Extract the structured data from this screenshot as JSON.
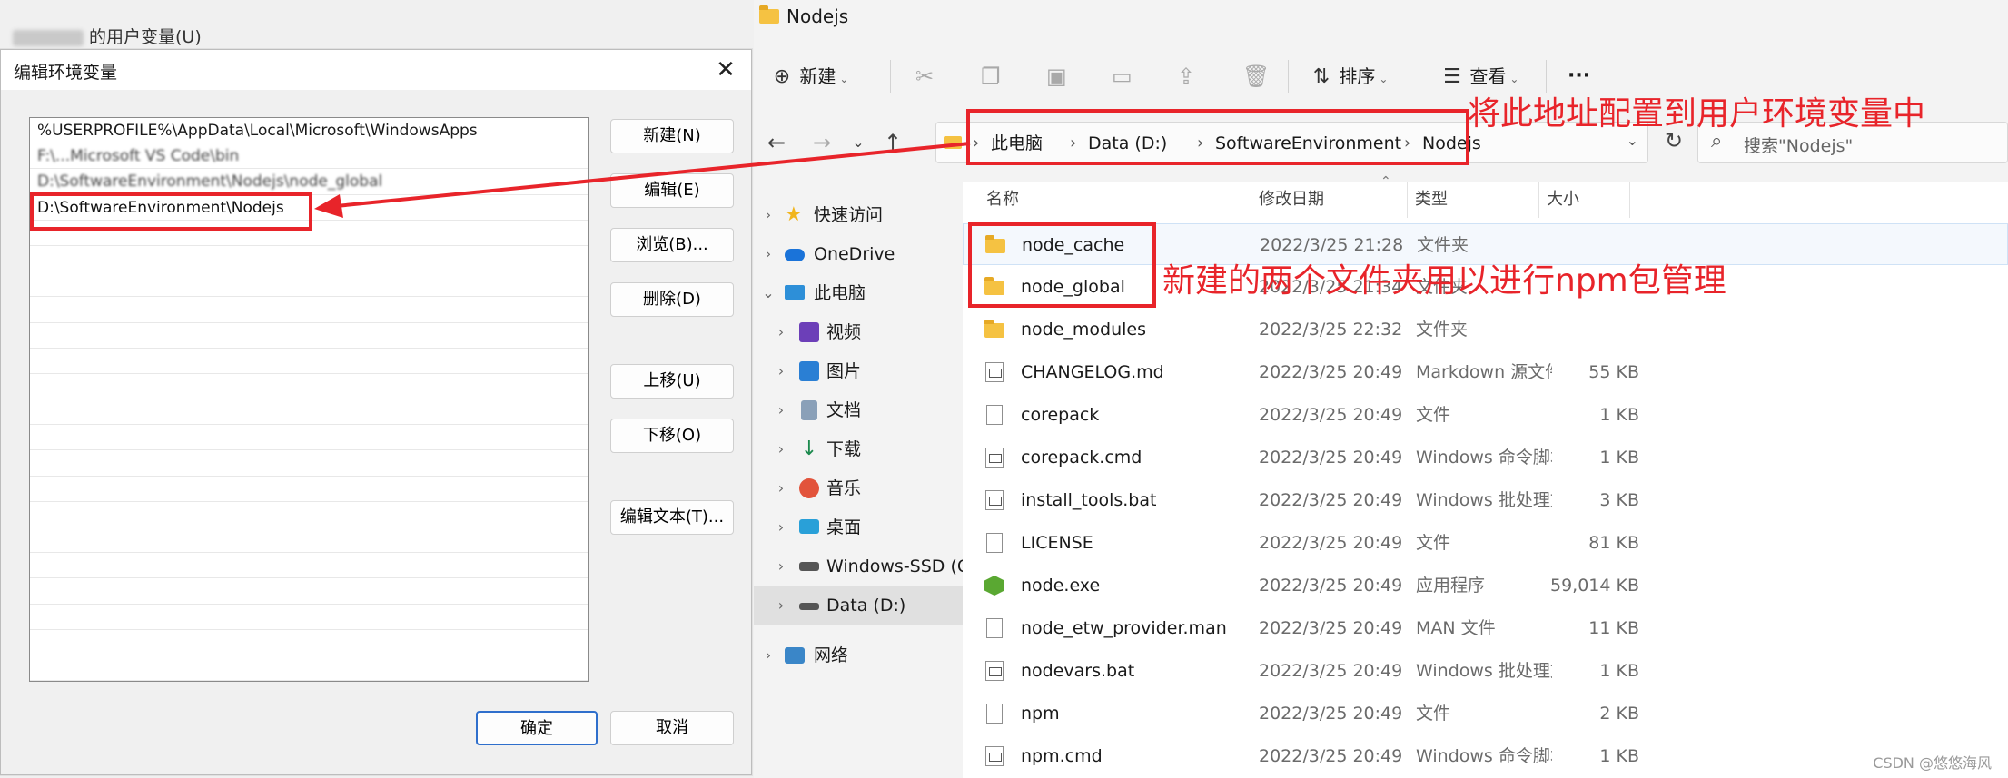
{
  "dialog": {
    "parent_title": "的用户变量(U)",
    "title": "编辑环境变量",
    "close_glyph": "✕",
    "paths": [
      "%USERPROFILE%\\AppData\\Local\\Microsoft\\WindowsApps",
      "F:\\...Microsoft VS Code\\bin",
      "D:\\SoftwareEnvironment\\Nodejs\\node_global",
      "D:\\SoftwareEnvironment\\Nodejs"
    ],
    "buttons": {
      "new": "新建(N)",
      "edit": "编辑(E)",
      "browse": "浏览(B)...",
      "delete": "删除(D)",
      "move_up": "上移(U)",
      "move_down": "下移(O)",
      "edit_text": "编辑文本(T)...",
      "ok": "确定",
      "cancel": "取消"
    }
  },
  "explorer": {
    "title": "Nodejs",
    "toolbar": {
      "new": "新建",
      "sort": "排序",
      "view": "查看",
      "more": "···"
    },
    "breadcrumb": [
      "此电脑",
      "Data (D:)",
      "SoftwareEnvironment",
      "Nodejs"
    ],
    "search_placeholder": "搜索\"Nodejs\"",
    "columns": {
      "name": "名称",
      "date": "修改日期",
      "type": "类型",
      "size": "大小"
    },
    "nav": [
      {
        "label": "快速访问",
        "icon": "star-icon"
      },
      {
        "label": "OneDrive",
        "icon": "cloud-icon"
      },
      {
        "label": "此电脑",
        "icon": "computer-icon"
      },
      {
        "label": "视频",
        "icon": "video-icon"
      },
      {
        "label": "图片",
        "icon": "picture-icon"
      },
      {
        "label": "文档",
        "icon": "document-icon"
      },
      {
        "label": "下载",
        "icon": "download-icon"
      },
      {
        "label": "音乐",
        "icon": "music-icon"
      },
      {
        "label": "桌面",
        "icon": "desktop-icon"
      },
      {
        "label": "Windows-SSD (C",
        "icon": "drive-icon"
      },
      {
        "label": "Data (D:)",
        "icon": "drive-icon"
      },
      {
        "label": "网络",
        "icon": "network-icon"
      }
    ],
    "files": [
      {
        "name": "node_cache",
        "date": "2022/3/25 21:28",
        "type": "文件夹",
        "size": "",
        "kind": "folder"
      },
      {
        "name": "node_global",
        "date": "2022/3/25 21:34",
        "type": "文件夹",
        "size": "",
        "kind": "folder"
      },
      {
        "name": "node_modules",
        "date": "2022/3/25 22:32",
        "type": "文件夹",
        "size": "",
        "kind": "folder"
      },
      {
        "name": "CHANGELOG.md",
        "date": "2022/3/25 20:49",
        "type": "Markdown 源文件",
        "size": "55 KB",
        "kind": "script"
      },
      {
        "name": "corepack",
        "date": "2022/3/25 20:49",
        "type": "文件",
        "size": "1 KB",
        "kind": "doc"
      },
      {
        "name": "corepack.cmd",
        "date": "2022/3/25 20:49",
        "type": "Windows 命令脚本",
        "size": "1 KB",
        "kind": "script"
      },
      {
        "name": "install_tools.bat",
        "date": "2022/3/25 20:49",
        "type": "Windows 批处理文...",
        "size": "3 KB",
        "kind": "script"
      },
      {
        "name": "LICENSE",
        "date": "2022/3/25 20:49",
        "type": "文件",
        "size": "81 KB",
        "kind": "doc"
      },
      {
        "name": "node.exe",
        "date": "2022/3/25 20:49",
        "type": "应用程序",
        "size": "59,014 KB",
        "kind": "exe"
      },
      {
        "name": "node_etw_provider.man",
        "date": "2022/3/25 20:49",
        "type": "MAN 文件",
        "size": "11 KB",
        "kind": "doc"
      },
      {
        "name": "nodevars.bat",
        "date": "2022/3/25 20:49",
        "type": "Windows 批处理文...",
        "size": "1 KB",
        "kind": "script"
      },
      {
        "name": "npm",
        "date": "2022/3/25 20:49",
        "type": "文件",
        "size": "2 KB",
        "kind": "doc"
      },
      {
        "name": "npm.cmd",
        "date": "2022/3/25 20:49",
        "type": "Windows 命令脚本",
        "size": "1 KB",
        "kind": "script"
      }
    ]
  },
  "annotations": {
    "address_note": "将此地址配置到用户环境变量中",
    "folders_note": "新建的两个文件夹用以进行npm包管理"
  },
  "watermark": "CSDN @悠悠海风",
  "colors": {
    "annotation_red": "#e8242a",
    "folder_yellow": "#f5c242",
    "accent_blue": "#2f6fcc"
  }
}
